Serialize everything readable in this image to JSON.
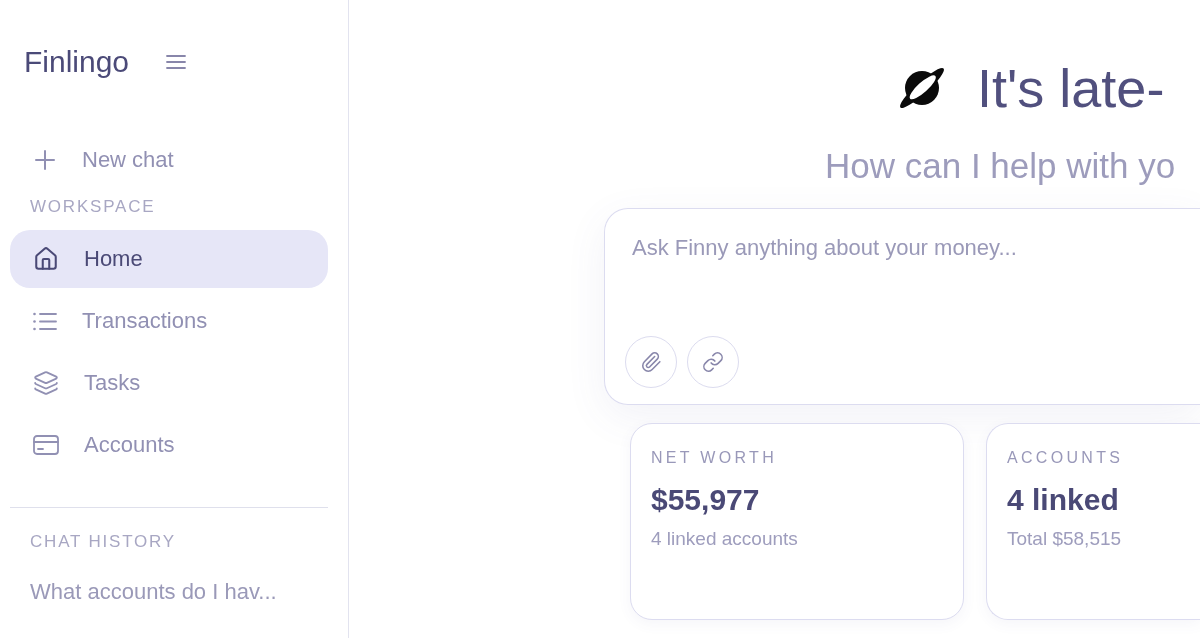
{
  "sidebar": {
    "brand": "Finlingo",
    "new_chat": "New chat",
    "workspace_heading": "WORKSPACE",
    "nav_items": [
      {
        "label": "Home",
        "selected": true
      },
      {
        "label": "Transactions",
        "selected": false
      },
      {
        "label": "Tasks",
        "selected": false
      },
      {
        "label": "Accounts",
        "selected": false
      }
    ],
    "history_heading": "CHAT HISTORY",
    "history_items": [
      "What accounts do I hav..."
    ]
  },
  "main": {
    "greeting": "It's late-",
    "subtitle": "How can I help with yo",
    "composer": {
      "placeholder": "Ask Finny anything about your money..."
    },
    "stat_cards": [
      {
        "label": "NET WORTH",
        "value": "$55,977",
        "detail": "4 linked accounts"
      },
      {
        "label": "ACCOUNTS",
        "value": "4 linked",
        "detail": "Total $58,515"
      }
    ]
  }
}
